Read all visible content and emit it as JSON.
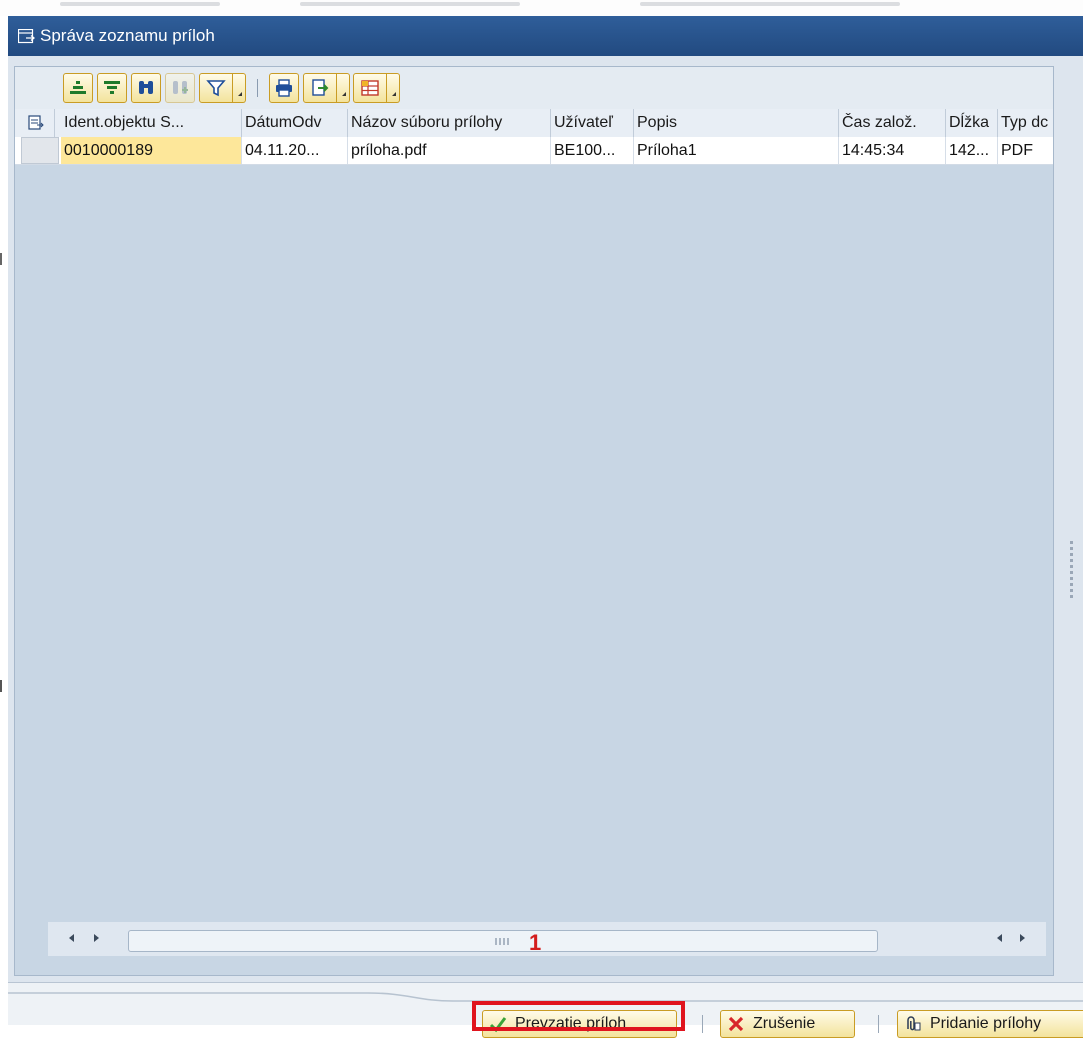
{
  "window": {
    "title": "Správa zoznamu príloh"
  },
  "toolbar": {
    "buttons": [
      {
        "icon": "sort-ascending-icon"
      },
      {
        "icon": "sort-descending-icon"
      },
      {
        "icon": "find-icon"
      },
      {
        "icon": "find-next-icon",
        "disabled": true
      },
      {
        "icon": "filter-icon"
      },
      {
        "icon": "print-icon"
      },
      {
        "icon": "export-icon"
      },
      {
        "icon": "layout-icon"
      }
    ]
  },
  "table": {
    "columns": [
      "Ident.objektu S...",
      "DátumOdv",
      "Názov súboru prílohy",
      "Užívateľ",
      "Popis",
      "Čas založ.",
      "Dĺžka",
      "Typ dc"
    ],
    "rows": [
      [
        "0010000189",
        "04.11.20...",
        "príloha.pdf",
        "BE100...",
        "Príloha1",
        "14:45:34",
        "142...",
        "PDF"
      ]
    ]
  },
  "annotation": {
    "label": "1",
    "color": "#d31d1d"
  },
  "footer": {
    "confirm_label": "Prevzatie príloh",
    "cancel_label": "Zrušenie",
    "add_label": "Pridanie prílohy"
  },
  "colors": {
    "titlebar": "#2a5589",
    "button_face": "#f7ebb4",
    "key_cell": "#fde79a",
    "highlight_box": "#e0141e"
  }
}
